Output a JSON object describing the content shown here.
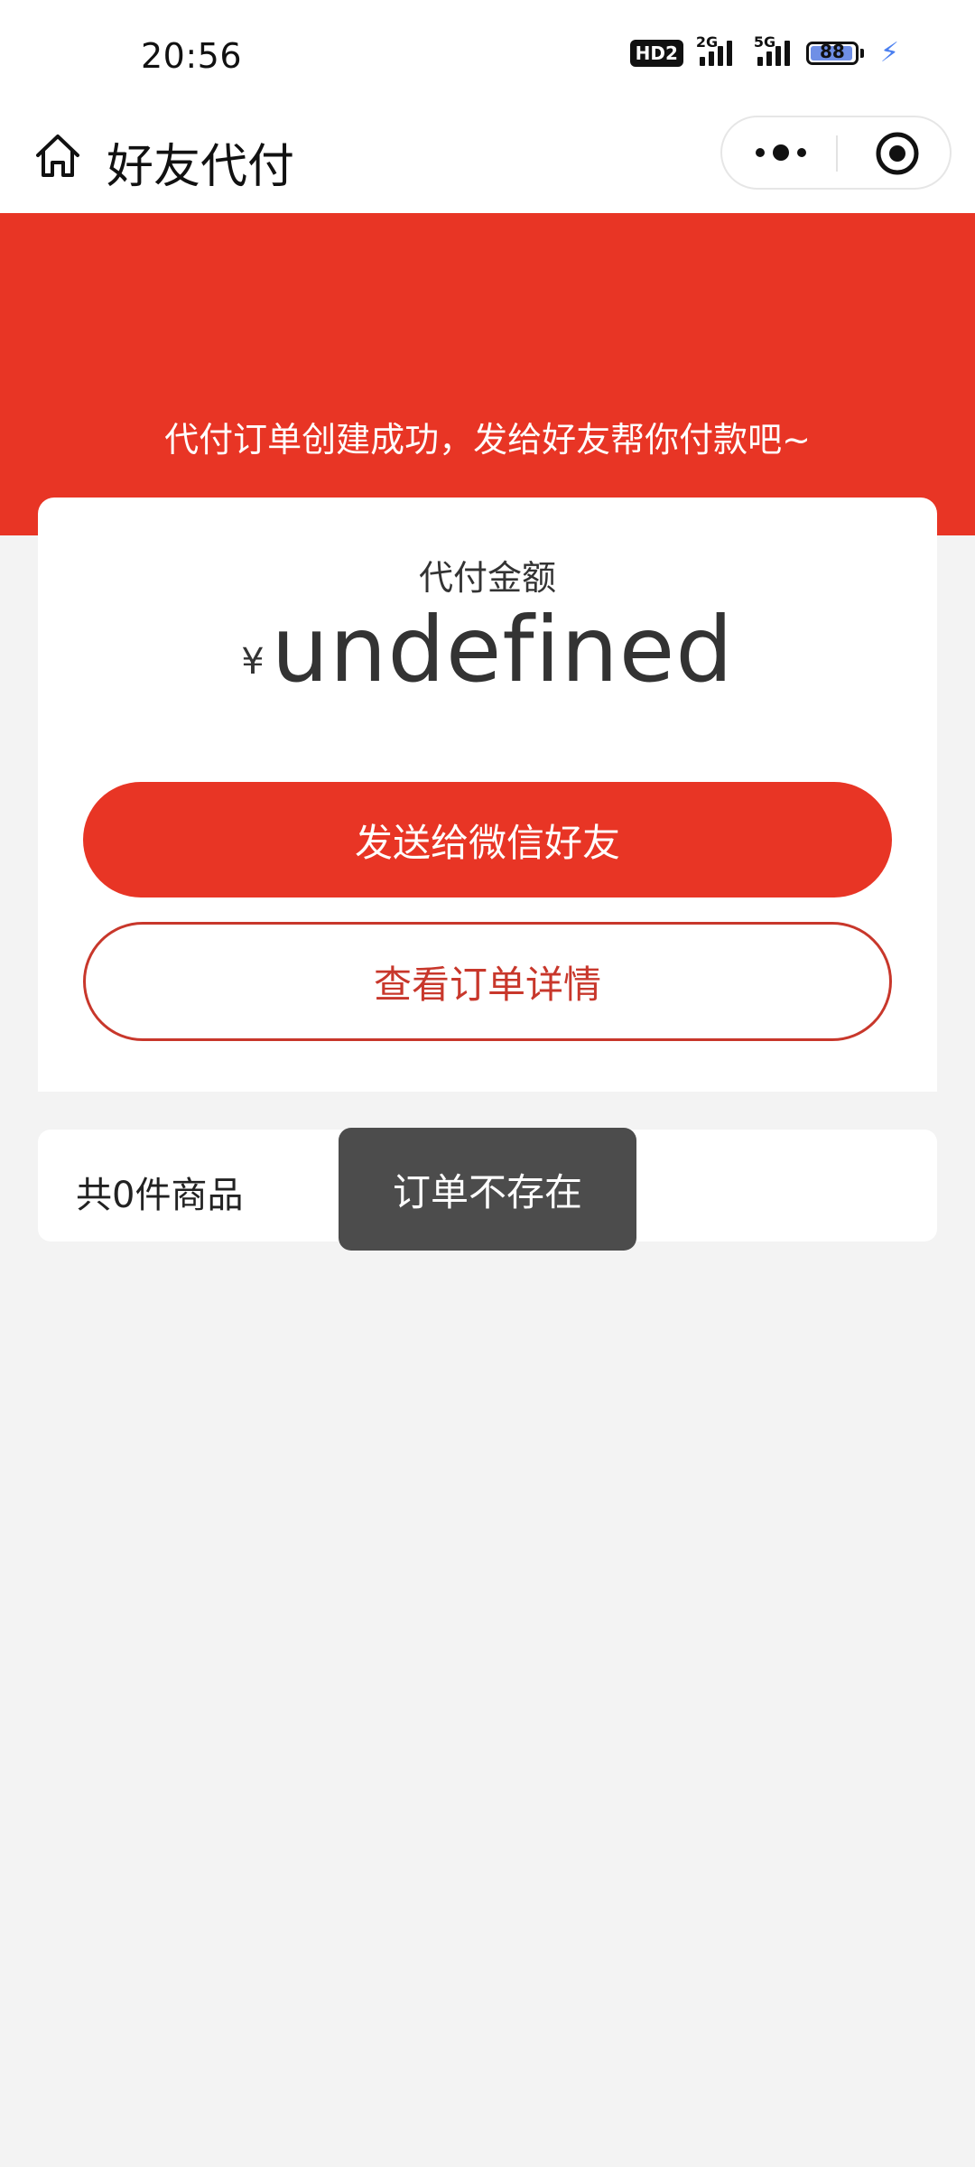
{
  "status_bar": {
    "time": "20:56",
    "hd_badge": "HD2",
    "network_1": "2G",
    "network_2": "5G",
    "battery_level": "88",
    "icons": [
      "hd-icon",
      "signal-icon",
      "signal-icon",
      "battery-icon",
      "charging-icon"
    ]
  },
  "nav": {
    "title": "好友代付",
    "home_icon": "home-icon",
    "more_icon": "more-dots-icon",
    "close_icon": "target-close-icon"
  },
  "banner": {
    "message": "代付订单创建成功，发给好友帮你付款吧~"
  },
  "amount_card": {
    "label": "代付金额",
    "currency_symbol": "¥",
    "amount": "undefined",
    "send_button_label": "发送给微信好友",
    "view_order_button_label": "查看订单详情"
  },
  "goods": {
    "count_text": "共0件商品"
  },
  "toast": {
    "message": "订单不存在"
  },
  "colors": {
    "brand_red": "#e83525",
    "outline_red": "#c8372b",
    "toast_bg": "#4c4c4c",
    "page_bg": "#f3f3f3"
  }
}
